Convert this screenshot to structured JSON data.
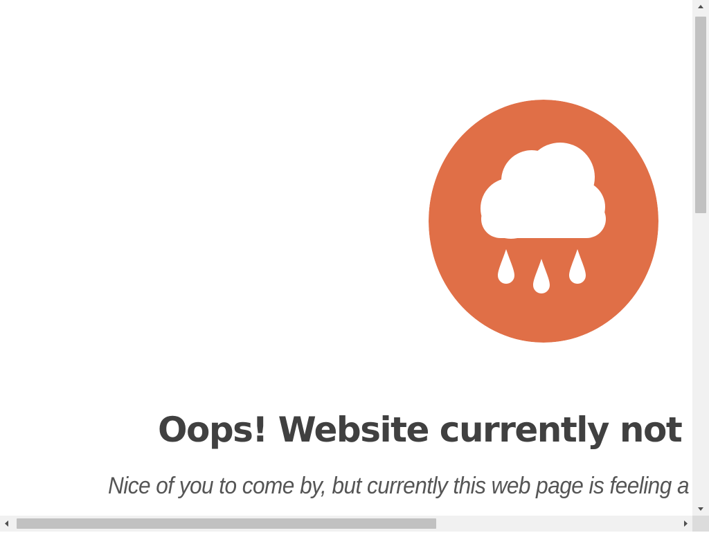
{
  "page": {
    "headline": "Oops! Website currently not available",
    "subtext": "Nice of you to come by, but currently this web page is feeling a little under the weather."
  },
  "icon": {
    "name": "rain-cloud-icon",
    "badge_color": "#e06f47",
    "glyph_color": "#ffffff"
  },
  "colors": {
    "headline": "#404040",
    "subtext": "#555555",
    "background": "#ffffff",
    "scrollbar_track": "#f1f1f1",
    "scrollbar_thumb": "#c1c1c1",
    "scrollbar_arrow": "#505050"
  },
  "scroll": {
    "vertical_position": 0,
    "horizontal_position": 0
  }
}
